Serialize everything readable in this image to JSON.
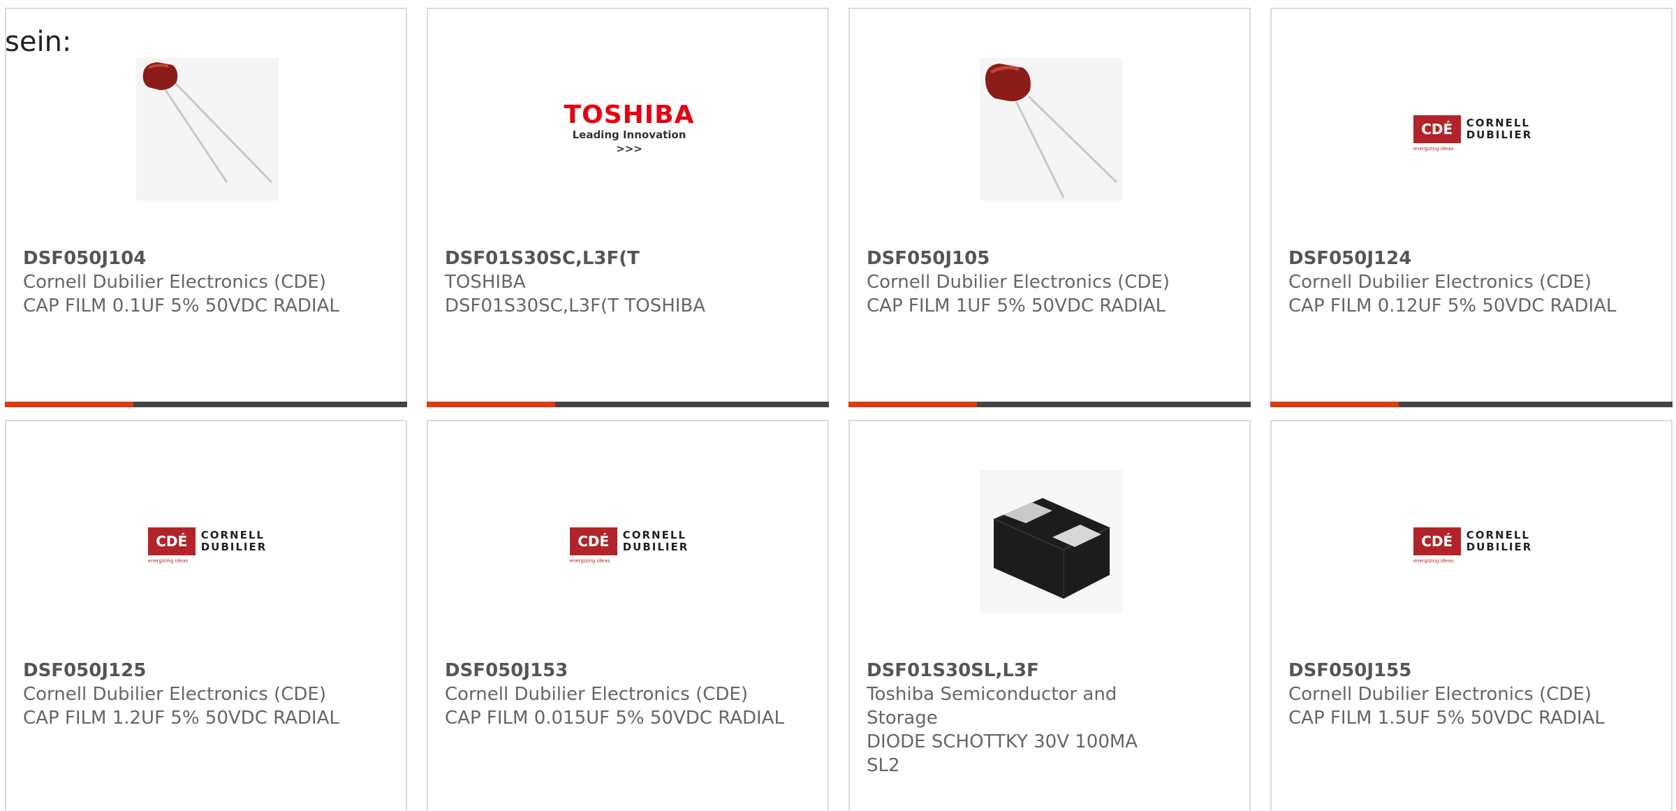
{
  "intro_text": "sein:",
  "products": [
    {
      "part_number": "DSF050J104",
      "manufacturer": "Cornell Dubilier Electronics (CDE)",
      "description": "CAP FILM 0.1UF 5% 50VDC RADIAL",
      "image": "film-capacitor-photo"
    },
    {
      "part_number": "DSF01S30SC,L3F(T",
      "manufacturer": "TOSHIBA",
      "description": "DSF01S30SC,L3F(T TOSHIBA",
      "image": "toshiba-logo",
      "logo_brand": "TOSHIBA",
      "logo_tagline": "Leading Innovation >>>"
    },
    {
      "part_number": "DSF050J105",
      "manufacturer": "Cornell Dubilier Electronics (CDE)",
      "description": "CAP FILM 1UF 5% 50VDC RADIAL",
      "image": "film-capacitor-photo"
    },
    {
      "part_number": "DSF050J124",
      "manufacturer": "Cornell Dubilier Electronics (CDE)",
      "description": "CAP FILM 0.12UF 5% 50VDC RADIAL",
      "image": "cde-logo"
    },
    {
      "part_number": "DSF050J125",
      "manufacturer": "Cornell Dubilier Electronics (CDE)",
      "description": "CAP FILM 1.2UF 5% 50VDC RADIAL",
      "image": "cde-logo"
    },
    {
      "part_number": "DSF050J153",
      "manufacturer": "Cornell Dubilier Electronics (CDE)",
      "description": "CAP FILM 0.015UF 5% 50VDC RADIAL",
      "image": "cde-logo"
    },
    {
      "part_number": "DSF01S30SL,L3F",
      "manufacturer": "Toshiba Semiconductor and Storage",
      "description": "DIODE SCHOTTKY 30V 100MA SL2",
      "image": "smd-diode-photo"
    },
    {
      "part_number": "DSF050J155",
      "manufacturer": "Cornell Dubilier Electronics (CDE)",
      "description": "CAP FILM 1.5UF 5% 50VDC RADIAL",
      "image": "cde-logo"
    }
  ],
  "cde_logo": {
    "mark": "CDÉ",
    "words_line1": "CORNELL",
    "words_line2": "DUBILIER",
    "tagline": "energizing ideas"
  },
  "colors": {
    "accent": "#e03a0e",
    "bar": "#444444",
    "cde_red": "#b3242a",
    "toshiba_red": "#e60012"
  }
}
